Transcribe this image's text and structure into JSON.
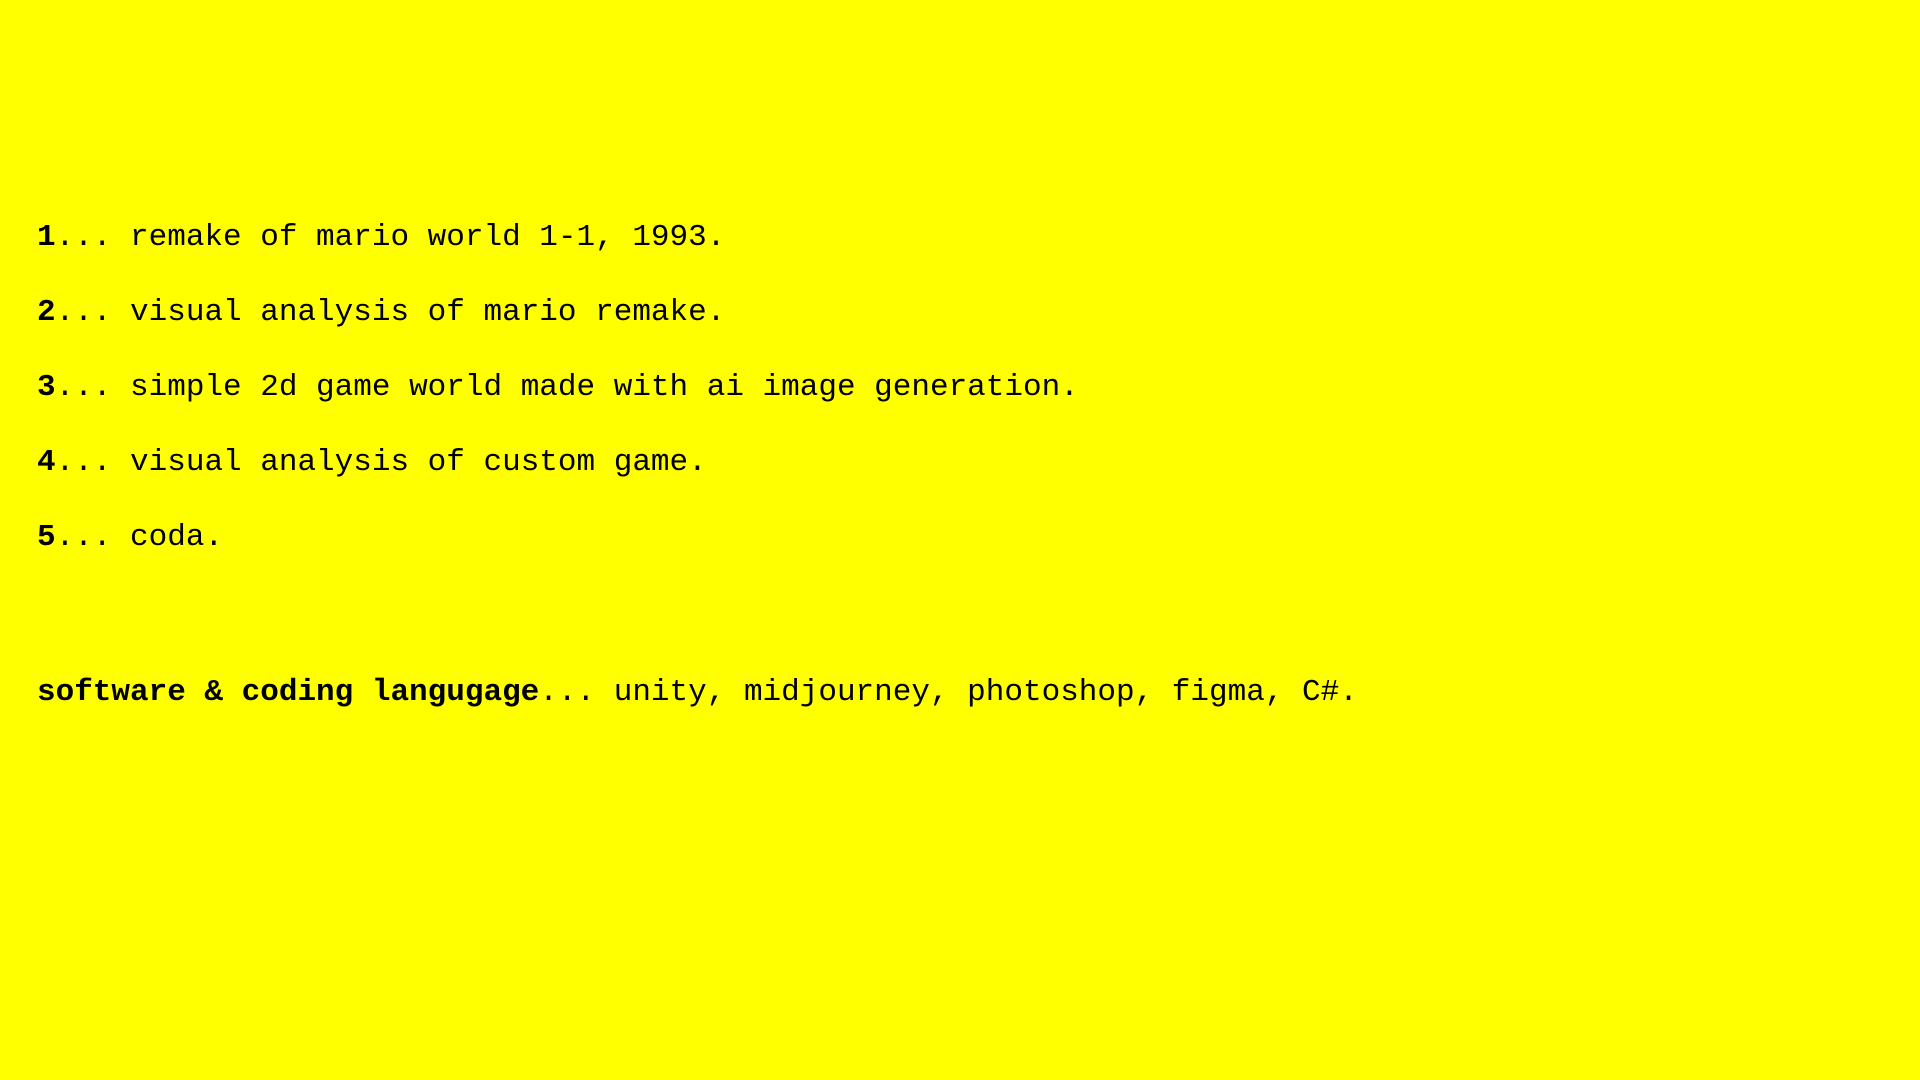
{
  "colors": {
    "background": "#ffff00",
    "text": "#000000"
  },
  "items": [
    {
      "num": "1",
      "sep": "... ",
      "text": "remake of mario world 1-1, 1993."
    },
    {
      "num": "2",
      "sep": "... ",
      "text": "visual analysis of mario remake."
    },
    {
      "num": "3",
      "sep": "... ",
      "text": "simple 2d game world made with ai image generation."
    },
    {
      "num": "4",
      "sep": "... ",
      "text": "visual analysis of custom game."
    },
    {
      "num": "5",
      "sep": "... ",
      "text": "coda."
    }
  ],
  "software": {
    "label": "software & coding langugage",
    "sep": "... ",
    "text": "unity, midjourney, photoshop, figma, C#."
  }
}
